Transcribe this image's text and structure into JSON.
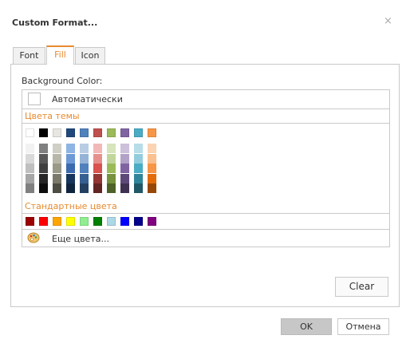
{
  "dialog": {
    "title": "Custom Format...",
    "close_glyph": "×"
  },
  "tabs": [
    {
      "label": "Font",
      "active": false
    },
    {
      "label": "Fill",
      "active": true
    },
    {
      "label": "Icon",
      "active": false
    }
  ],
  "fill": {
    "background_label": "Background Color:",
    "automatic_label": "Автоматически",
    "theme_colors_label": "Цвета темы",
    "standard_colors_label": "Стандартные цвета",
    "more_colors_label": "Еще цвета...",
    "more_colors_icon": "palette-icon",
    "theme_colors": [
      {
        "base": "#ffffff",
        "shades": [
          "#f2f2f2",
          "#d9d9d9",
          "#bfbfbf",
          "#a6a6a6",
          "#808080"
        ]
      },
      {
        "base": "#000000",
        "shades": [
          "#808080",
          "#595959",
          "#404040",
          "#262626",
          "#0d0d0d"
        ]
      },
      {
        "base": "#e7e6e0",
        "shades": [
          "#d0cfc6",
          "#b8b7aa",
          "#9b9a89",
          "#7a796b",
          "#4e4d44"
        ]
      },
      {
        "base": "#1f497d",
        "shades": [
          "#8eb4e3",
          "#6d9ad6",
          "#3b6bae",
          "#17365d",
          "#0f243e"
        ]
      },
      {
        "base": "#4f81bd",
        "shades": [
          "#b8cce4",
          "#95b3d7",
          "#4f81bd",
          "#366092",
          "#244061"
        ]
      },
      {
        "base": "#c0504d",
        "shades": [
          "#f2b8b7",
          "#e6908e",
          "#d9534f",
          "#943634",
          "#632423"
        ]
      },
      {
        "base": "#9bbb59",
        "shades": [
          "#d7e4bc",
          "#c2d69b",
          "#9bbb59",
          "#76923c",
          "#4f6228"
        ]
      },
      {
        "base": "#8064a2",
        "shades": [
          "#ccc0da",
          "#b2a2c7",
          "#8064a2",
          "#5f497a",
          "#3f3151"
        ]
      },
      {
        "base": "#4bacc6",
        "shades": [
          "#b7dde8",
          "#93cddd",
          "#4bacc6",
          "#31859b",
          "#205867"
        ]
      },
      {
        "base": "#f79646",
        "shades": [
          "#fbd4b4",
          "#fac08f",
          "#f79646",
          "#e36c09",
          "#974806"
        ]
      }
    ],
    "standard_colors": [
      "#9b0000",
      "#ff0000",
      "#ffa500",
      "#ffff00",
      "#90ee90",
      "#008000",
      "#add8e6",
      "#0000ff",
      "#00008b",
      "#800080"
    ],
    "clear_label": "Clear"
  },
  "footer": {
    "ok_label": "OK",
    "cancel_label": "Отмена"
  },
  "colors": {
    "accent": "#e88a2e",
    "border": "#c9c9c9",
    "ok_bg": "#c7c7c7"
  }
}
